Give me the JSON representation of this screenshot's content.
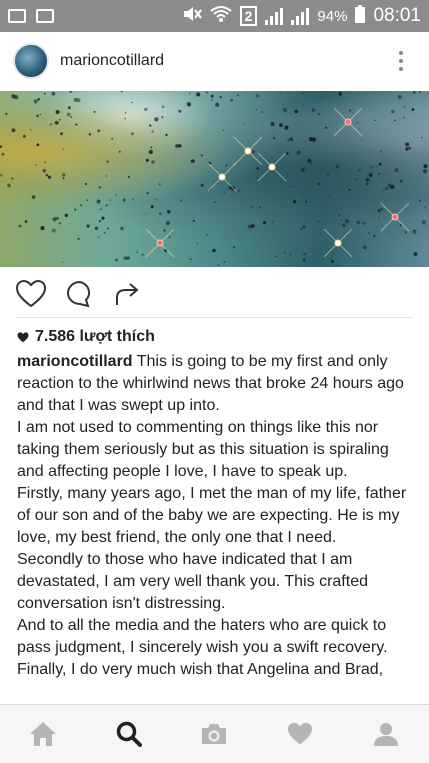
{
  "status_bar": {
    "signal_badge": "2",
    "battery": "94%",
    "time": "08:01",
    "icons": [
      "gallery-icon",
      "image-notification-icon",
      "mute-icon",
      "wifi-icon",
      "sim-icon",
      "signal-icon",
      "battery-icon"
    ]
  },
  "header": {
    "username": "marioncotillard",
    "menu_icon": "more-vertical-icon"
  },
  "post": {
    "image_description_icon": "starfield-image",
    "actions": [
      "heart-icon",
      "comment-icon",
      "share-icon"
    ],
    "likes": "7.586 lượt thích",
    "caption": {
      "author": "marioncotillard",
      "lines": [
        "This is going to be my first and only reaction to the whirlwind news that broke 24 hours ago and that I was swept up into.",
        "I am not used to commenting on things like this nor taking them seriously but as this situation is spiraling and affecting people I love, I have to speak up.",
        "Firstly, many years ago, I met the man of my life, father of our son and of the baby we are expecting. He is my love, my best friend, the only one that I need.",
        "Secondly to those who have indicated that I am devastated, I am very well thank you. This crafted conversation isn't distressing.",
        "And to all the media and the haters who are quick to pass judgment, I sincerely wish you a swift recovery.",
        "Finally, I do very much wish that Angelina and Brad,"
      ]
    }
  },
  "bottom_nav": {
    "items": [
      "home-icon",
      "search-icon",
      "camera-icon",
      "activity-heart-icon",
      "profile-icon"
    ],
    "active": "search-icon",
    "colors": {
      "active": "#222222",
      "inactive": "#b5b5b5"
    }
  }
}
